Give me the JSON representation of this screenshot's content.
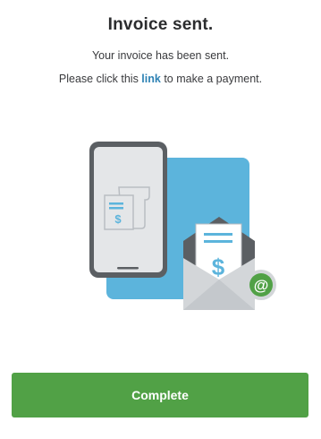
{
  "header": {
    "title": "Invoice sent."
  },
  "message": {
    "line1": "Your invoice has been sent.",
    "line2_before": "Please click this ",
    "link_label": "link",
    "line2_after": " to make a payment."
  },
  "illustration": {
    "phone_icon": "invoice-document-icon",
    "envelope_icon": "envelope-icon",
    "email_badge_text": "@",
    "currency_symbol": "$"
  },
  "actions": {
    "complete_label": "Complete"
  },
  "colors": {
    "accent_green": "#51a146",
    "link_blue": "#2e82b4",
    "illustration_blue": "#5cb4dc",
    "phone_frame": "#5b5f63",
    "phone_screen": "#e4e6e8"
  }
}
